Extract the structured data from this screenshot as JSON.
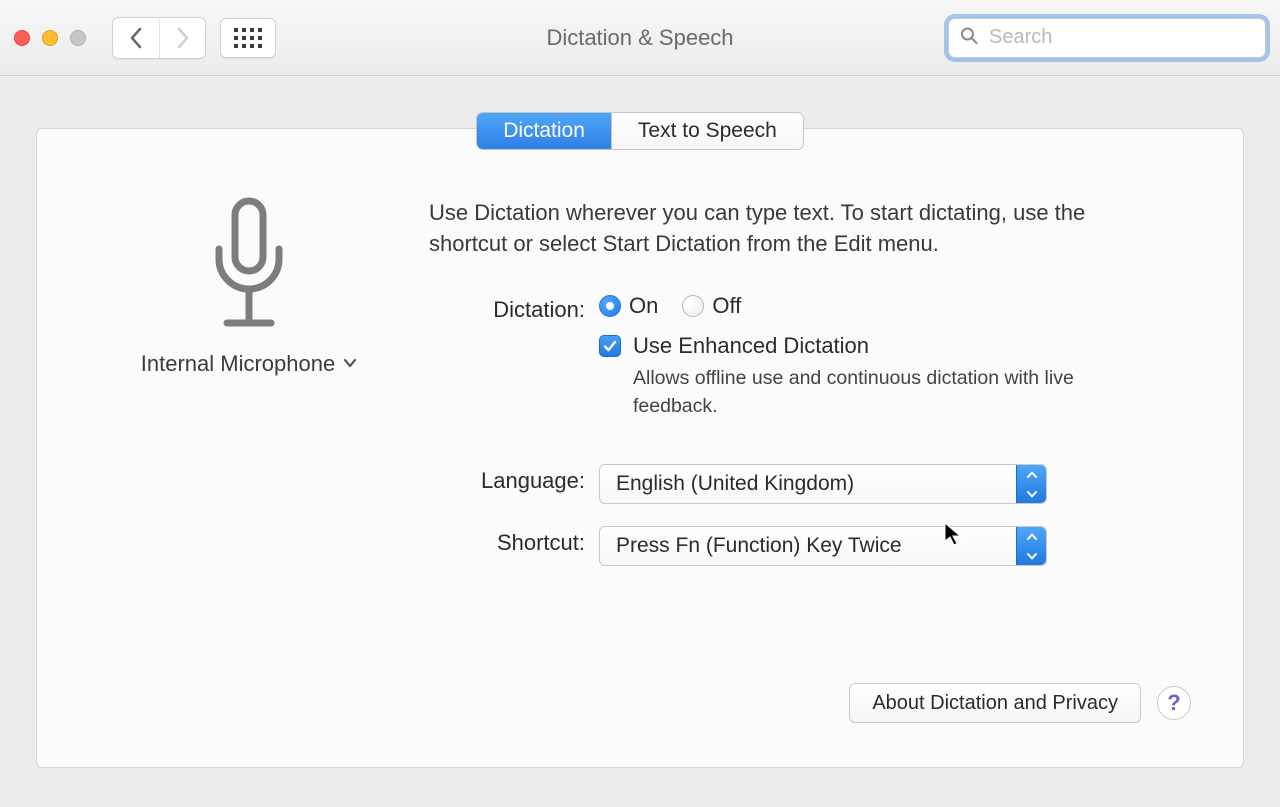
{
  "window": {
    "title": "Dictation & Speech",
    "search_placeholder": "Search"
  },
  "tabs": {
    "dictation": "Dictation",
    "tts": "Text to Speech",
    "selected": "dictation"
  },
  "mic": {
    "label": "Internal Microphone"
  },
  "intro": "Use Dictation wherever you can type text. To start dictating, use the shortcut or select Start Dictation from the Edit menu.",
  "labels": {
    "dictation": "Dictation:",
    "language": "Language:",
    "shortcut": "Shortcut:"
  },
  "dictation": {
    "on": "On",
    "off": "Off",
    "selected": "on",
    "enhanced_label": "Use Enhanced Dictation",
    "enhanced_checked": true,
    "enhanced_help": "Allows offline use and continuous dictation with live feedback."
  },
  "language": {
    "value": "English (United Kingdom)"
  },
  "shortcut": {
    "value": "Press Fn (Function) Key Twice"
  },
  "footer": {
    "about": "About Dictation and Privacy",
    "help": "?"
  }
}
